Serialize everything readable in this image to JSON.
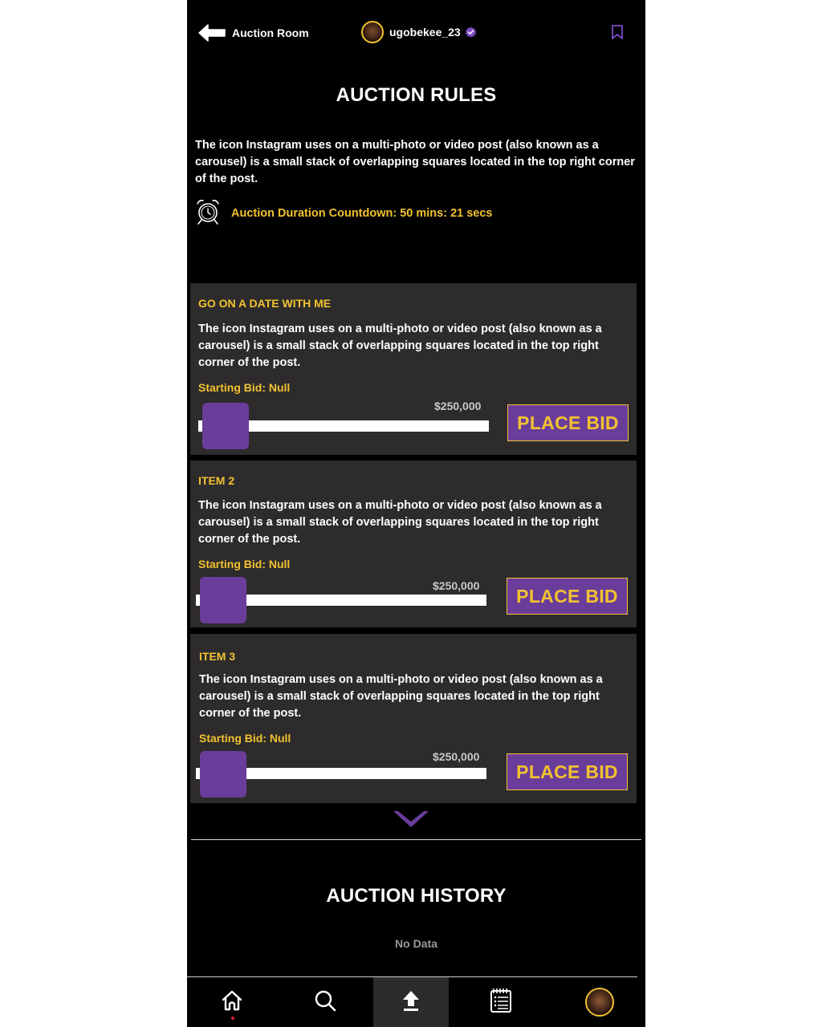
{
  "header": {
    "back_label": "Auction Room",
    "back_icon": "arrow-left-icon",
    "username": "ugobekee_23",
    "verified_icon": "verified-badge-icon",
    "bookmark_icon": "bookmark-icon"
  },
  "rules": {
    "title": "AUCTION RULES",
    "text": "The icon Instagram uses on a multi-photo or video post (also known as a carousel) is a small stack of overlapping squares located in the top right corner of the post.",
    "countdown_icon": "alarm-clock-icon",
    "countdown_text": "Auction Duration Countdown: 50 mins: 21 secs"
  },
  "items": [
    {
      "title": "GO ON A DATE WITH ME",
      "description": "The icon Instagram uses on a multi-photo or video post (also known as a carousel) is a small stack of overlapping squares located in the top right corner of the post.",
      "starting_bid": "Starting Bid: Null",
      "max_label": "$250,000",
      "slider_fraction": 0.0,
      "button_label": "PLACE BID"
    },
    {
      "title": "ITEM 2",
      "description": "The icon Instagram uses on a multi-photo or video post (also known as a carousel) is a small stack of overlapping squares located in the top right corner of the post.",
      "starting_bid": "Starting Bid: Null",
      "max_label": "$250,000",
      "slider_fraction": 0.0,
      "button_label": "PLACE BID"
    },
    {
      "title": "ITEM 3",
      "description": "The icon Instagram uses on a multi-photo or video post (also known as a carousel) is a small stack of overlapping squares located in the top right corner of the post.",
      "starting_bid": "Starting Bid: Null",
      "max_label": "$250,000",
      "slider_fraction": 0.0,
      "button_label": "PLACE BID"
    }
  ],
  "more_icon": "chevron-down-icon",
  "history": {
    "title": "AUCTION HISTORY",
    "empty_text": "No Data"
  },
  "bottom_nav": [
    {
      "icon": "home-icon",
      "active": false,
      "has_notification_dot": true
    },
    {
      "icon": "search-icon",
      "active": false
    },
    {
      "icon": "upload-icon",
      "active": true
    },
    {
      "icon": "list-icon",
      "active": false
    },
    {
      "icon": "profile-avatar",
      "active": false
    }
  ],
  "colors": {
    "background": "#000000",
    "card": "#2d2b2c",
    "accent_yellow": "#f2c230",
    "accent_purple": "#6a3d9a"
  }
}
